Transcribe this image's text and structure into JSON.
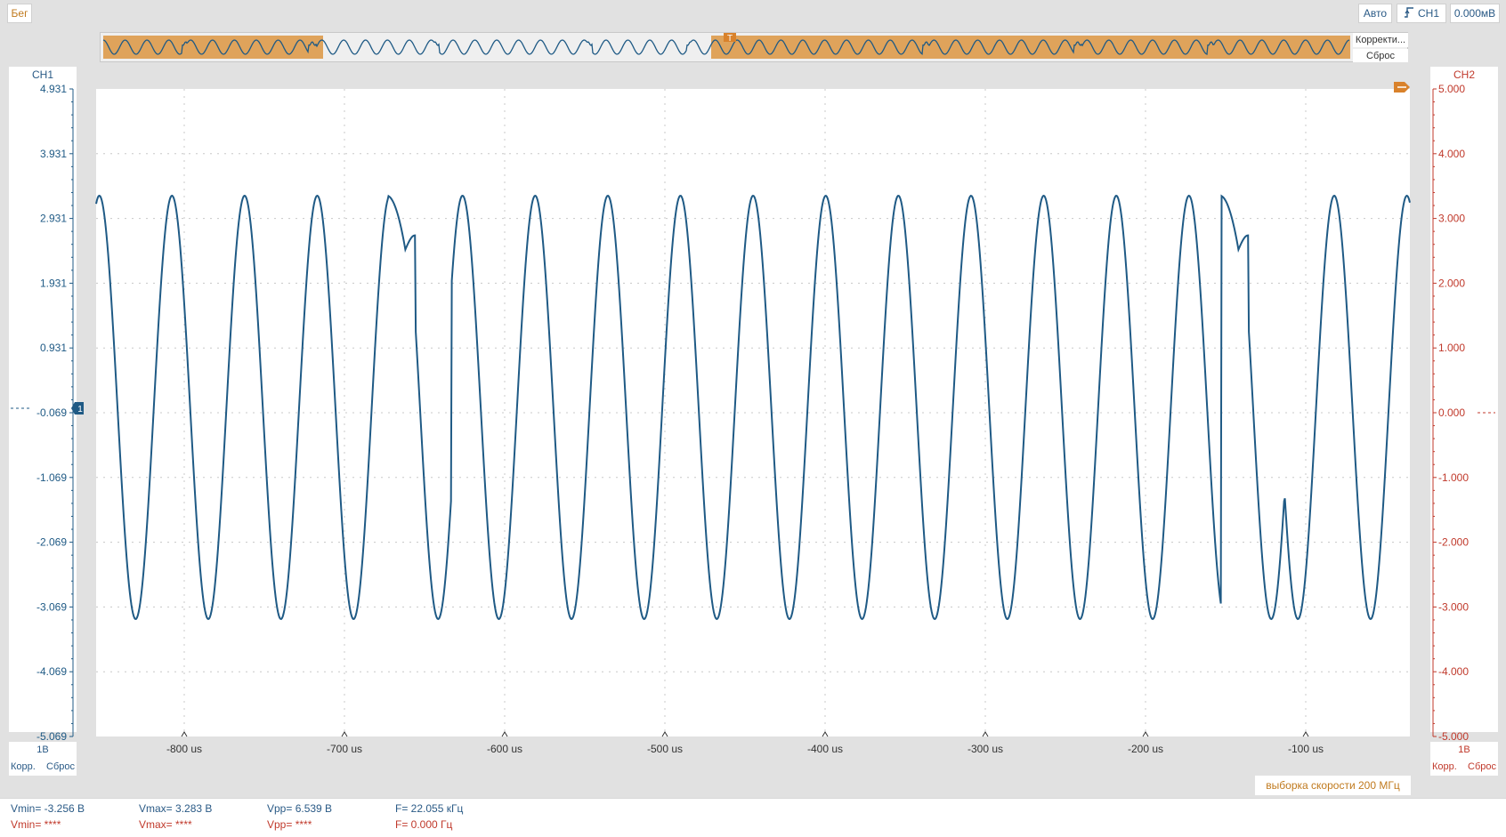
{
  "toolbar": {
    "run_label": "Бег",
    "auto_label": "Авто",
    "trigger_source": "CH1",
    "trigger_level": "0.000мВ"
  },
  "overview": {
    "adjust_label": "Корректи...",
    "reset_label": "Сброс",
    "trigger_marker": "T"
  },
  "ch1": {
    "label": "CH1",
    "scale": "1В",
    "adjust_label": "Корр.",
    "reset_label": "Сброс",
    "ticks": [
      "4.931",
      "3.931",
      "2.931",
      "1.931",
      "0.931",
      "-0.069",
      "-1.069",
      "-2.069",
      "-3.069",
      "-4.069",
      "-5.069"
    ],
    "marker": "1",
    "color": "#1f5a85"
  },
  "ch2": {
    "label": "CH2",
    "scale": "1В",
    "adjust_label": "Корр.",
    "reset_label": "Сброс",
    "ticks": [
      "5.000",
      "4.000",
      "3.000",
      "2.000",
      "1.000",
      "0.000",
      "-1.000",
      "-2.000",
      "-3.000",
      "-4.000",
      "-5.000"
    ],
    "color": "#c0392b"
  },
  "time_axis": {
    "ticks": [
      "-800 us",
      "-700 us",
      "-600 us",
      "-500 us",
      "-400 us",
      "-300 us",
      "-200 us",
      "-100 us"
    ]
  },
  "sample_rate": "выборка скорости 200 МГц",
  "measurements": {
    "ch1": {
      "vmin": "Vmin= -3.256 В",
      "vmax": "Vmax= 3.283 В",
      "vpp": "Vpp= 6.539 В",
      "freq": "F= 22.055 кГц"
    },
    "ch2": {
      "vmin": "Vmin= ****",
      "vmax": "Vmax= ****",
      "vpp": "Vpp= ****",
      "freq": "F= 0.000 Гц"
    }
  },
  "chart_data": {
    "type": "line",
    "xlabel": "",
    "ylabel": "",
    "xlim": [
      -855,
      -35
    ],
    "ylim": [
      -5.069,
      4.931
    ],
    "x_unit": "us",
    "series": [
      {
        "name": "CH1",
        "frequency_khz": 22.055,
        "vmin": -3.256,
        "vmax": 3.283,
        "peaks_x_us": [
          -853,
          -808,
          -763,
          -718,
          -673,
          -628,
          -583,
          -538,
          -493,
          -448,
          -403,
          -358,
          -313,
          -268,
          -223,
          -178,
          -133,
          -88,
          -43
        ],
        "glitches": [
          {
            "x_us": -662,
            "y": 2.45
          },
          {
            "x_us": -142,
            "y": 2.45
          }
        ]
      }
    ],
    "grid": true
  }
}
